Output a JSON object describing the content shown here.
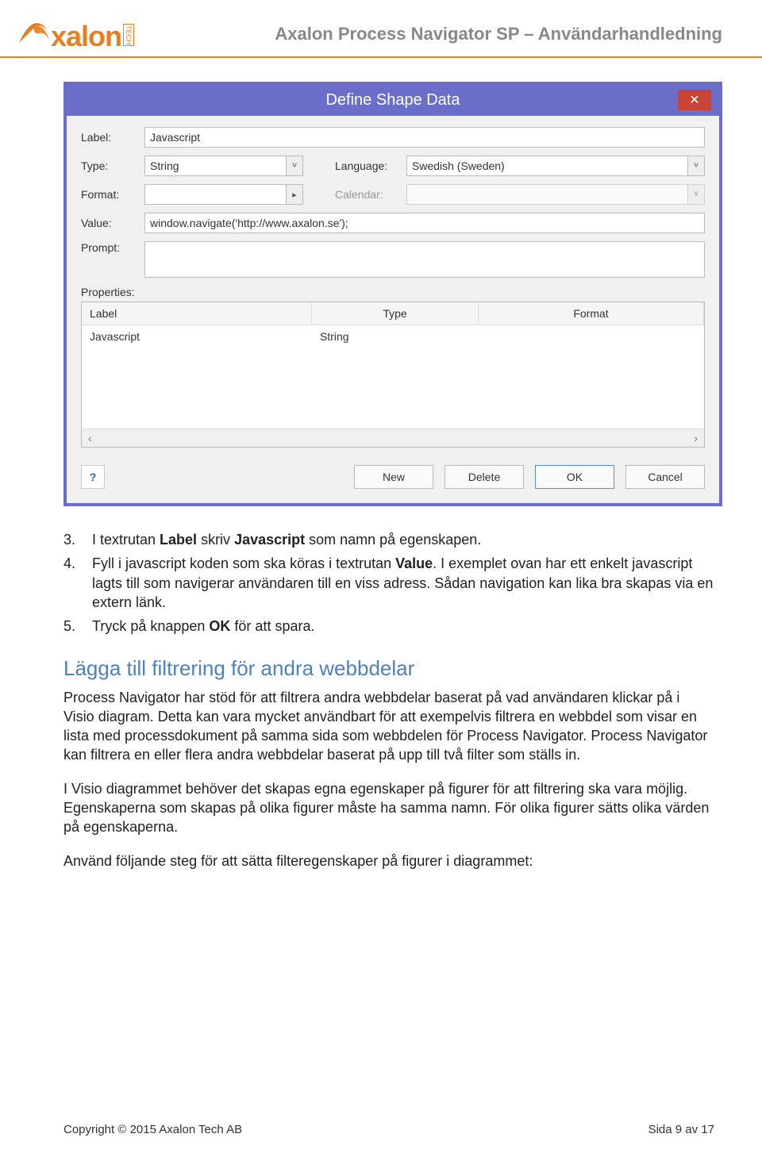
{
  "header": {
    "logo_text": "xalon",
    "logo_tech": "TECH",
    "title": "Axalon Process Navigator SP – Användarhandledning"
  },
  "dialog": {
    "title": "Define Shape Data",
    "close_glyph": "✕",
    "labels": {
      "label": "Label:",
      "type": "Type:",
      "language": "Language:",
      "format": "Format:",
      "calendar": "Calendar:",
      "value": "Value:",
      "prompt": "Prompt:",
      "properties": "Properties:"
    },
    "values": {
      "label": "Javascript",
      "type": "String",
      "language": "Swedish (Sweden)",
      "format": "",
      "calendar": "",
      "value": "window.navigate('http://www.axalon.se');",
      "prompt": ""
    },
    "grid": {
      "headers": {
        "label": "Label",
        "type": "Type",
        "format": "Format"
      },
      "rows": [
        {
          "label": "Javascript",
          "type": "String",
          "format": ""
        }
      ]
    },
    "buttons": {
      "new": "New",
      "delete": "Delete",
      "ok": "OK",
      "cancel": "Cancel"
    },
    "scroll": {
      "left": "‹",
      "right": "›"
    },
    "help_glyph": "?"
  },
  "doc": {
    "item3_num": "3.",
    "item3_a": "I textrutan ",
    "item3_b": "Label",
    "item3_c": " skriv ",
    "item3_d": "Javascript",
    "item3_e": " som namn på egenskapen.",
    "item4_num": "4.",
    "item4_a": "Fyll i javascript koden som ska köras i textrutan ",
    "item4_b": "Value",
    "item4_c": ". I exemplet ovan har ett enkelt javascript lagts till som navigerar användaren till en viss adress. Sådan navigation kan lika bra skapas via en extern länk.",
    "item5_num": "5.",
    "item5_a": "Tryck på knappen ",
    "item5_b": "OK",
    "item5_c": " för att spara.",
    "section_title": "Lägga till filtrering för andra webbdelar",
    "p1": "Process Navigator har stöd för att filtrera andra webbdelar baserat på vad användaren klickar på i Visio diagram. Detta kan vara mycket användbart för att exempelvis filtrera en webbdel som visar en lista med processdokument på samma sida som webbdelen för Process Navigator. Process Navigator kan filtrera en eller flera andra webbdelar baserat på upp till två filter som ställs in.",
    "p2": "I Visio diagrammet behöver det skapas egna egenskaper på figurer för att filtrering ska vara möjlig. Egenskaperna som skapas på olika figurer måste ha samma namn. För olika figurer sätts olika värden på egenskaperna.",
    "p3": "Använd följande steg för att sätta filteregenskaper på figurer i diagrammet:"
  },
  "footer": {
    "copyright": "Copyright © 2015 Axalon Tech AB",
    "page": "Sida 9 av 17"
  }
}
